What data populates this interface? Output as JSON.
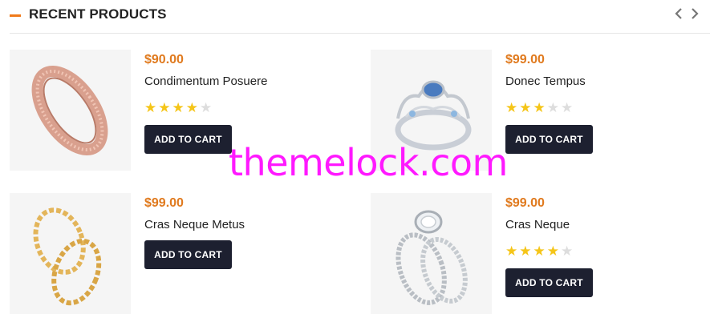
{
  "section": {
    "title": "RECENT PRODUCTS",
    "accent_color": "#f07a1a",
    "prev_icon": "chevron-left-icon",
    "next_icon": "chevron-right-icon"
  },
  "products": [
    {
      "price": "$90.00",
      "name": "Condimentum Posuere",
      "rating": 4,
      "max_rating": 5,
      "button_label": "ADD TO CART",
      "image_icon": "rose-gold-ring"
    },
    {
      "price": "$99.00",
      "name": "Donec Tempus",
      "rating": 3,
      "max_rating": 5,
      "button_label": "ADD TO CART",
      "image_icon": "blue-tiara-ring"
    },
    {
      "price": "$99.00",
      "name": "Cras Neque Metus",
      "rating": 0,
      "max_rating": 5,
      "button_label": "ADD TO CART",
      "image_icon": "gold-stacked-rings"
    },
    {
      "price": "$99.00",
      "name": "Cras Neque",
      "rating": 4,
      "max_rating": 5,
      "button_label": "ADD TO CART",
      "image_icon": "diamond-bridal-set"
    }
  ],
  "watermark": "themelock.com",
  "colors": {
    "price": "#e07a1e",
    "button_bg": "#1d2030",
    "star_on": "#f5c518",
    "star_off": "#dddddd",
    "watermark": "#ff19ff"
  }
}
